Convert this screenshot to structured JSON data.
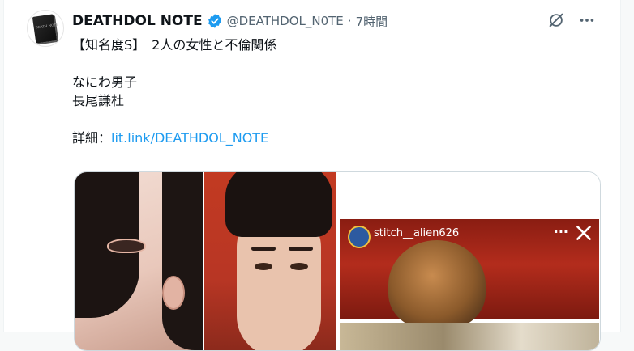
{
  "post": {
    "author_name": "DEATHDOL NOTE",
    "handle": "@DEATHDOL_N0TE",
    "separator": "·",
    "time": "7時間",
    "verified_color": "#1d9bf0",
    "avatar_lettering": "DEATH NOTE"
  },
  "text_lines": [
    "【知名度S】　2人の女性と不倫関係",
    "",
    "なにわ男子",
    "長尾謙杜",
    ""
  ],
  "detail": {
    "label": "詳細：",
    "link": "lit.link/DEATHDOL_NOTE",
    "link_color": "#1d9bf0"
  },
  "media": {
    "story_username": "stitch__alien626",
    "story_more": "···"
  },
  "icons": {
    "grok": "grok-icon",
    "more": "more-icon",
    "verified": "verified-badge-icon",
    "close": "close-icon"
  }
}
